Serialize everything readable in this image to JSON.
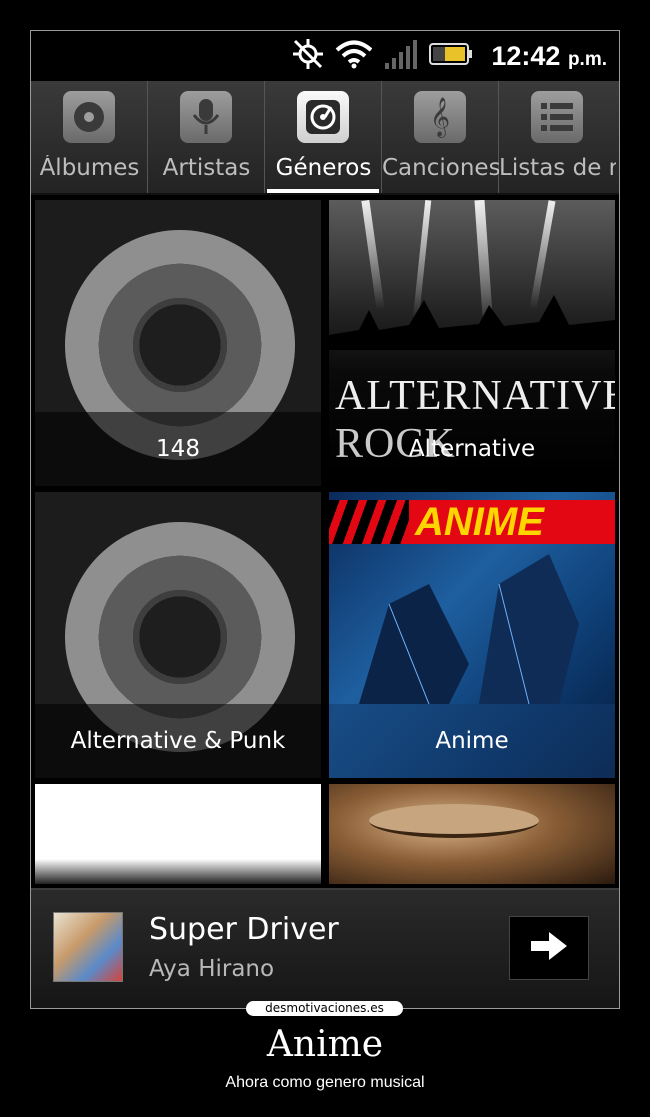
{
  "status_bar": {
    "time": "12:42",
    "ampm": "p.m.",
    "icons": [
      "gps-off-icon",
      "wifi-icon",
      "signal-icon",
      "battery-icon"
    ]
  },
  "tabs": [
    {
      "label": "Álbumes",
      "icon": "album-icon",
      "active": false
    },
    {
      "label": "Artistas",
      "icon": "microphone-icon",
      "active": false
    },
    {
      "label": "Géneros",
      "icon": "genre-disc-icon",
      "active": true
    },
    {
      "label": "Canciones",
      "icon": "treble-clef-icon",
      "active": false
    },
    {
      "label": "Listas de r",
      "icon": "playlist-icon",
      "active": false
    }
  ],
  "genres": [
    {
      "label": "148",
      "art": "default-disc"
    },
    {
      "label": "Alternative",
      "art": "alternative-rock-cover"
    },
    {
      "label": "Alternative & Punk",
      "art": "default-disc"
    },
    {
      "label": "Anime",
      "art": "anime-cover"
    },
    {
      "label": "",
      "art": "blank"
    },
    {
      "label": "",
      "art": "hat-photo"
    }
  ],
  "art_text": {
    "alternative_cover": "ALTERNATIVE ROCK",
    "anime_cover": "ANIME"
  },
  "now_playing": {
    "title": "Super Driver",
    "artist": "Aya Hirano"
  },
  "poster": {
    "watermark": "desmotivaciones.es",
    "title": "Anime",
    "subtitle": "Ahora como genero musical"
  },
  "colors": {
    "active_tab_underline": "#ffffff",
    "anime_banner_red": "#e30613",
    "anime_banner_yellow": "#ffd500"
  }
}
